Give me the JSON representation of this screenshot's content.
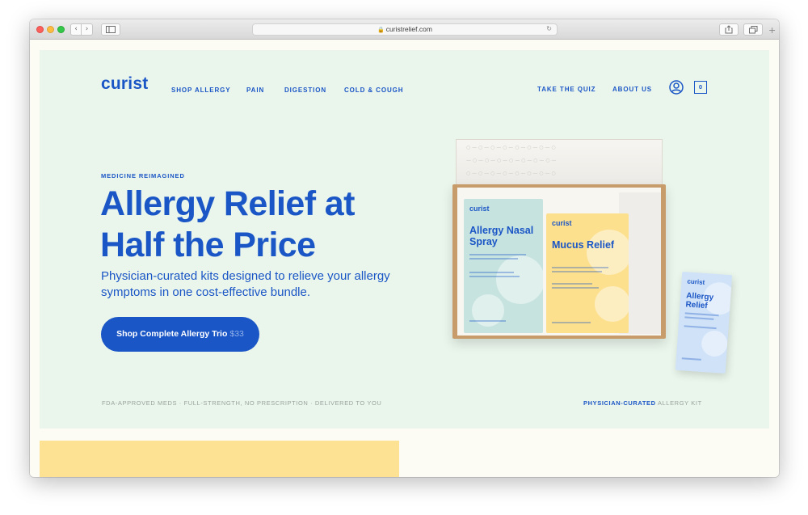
{
  "browser": {
    "url": "curistrelief.com",
    "icons": [
      "back-icon",
      "forward-icon",
      "sidebar-icon",
      "lock-icon",
      "reload-icon",
      "share-icon",
      "tabs-icon",
      "new-tab-icon"
    ]
  },
  "nav": {
    "logo": "curist",
    "links": [
      "SHOP ALLERGY",
      "PAIN",
      "DIGESTION",
      "COLD & COUGH"
    ],
    "right_links": [
      "TAKE THE QUIZ",
      "ABOUT US"
    ],
    "cart_count": "0"
  },
  "hero": {
    "kicker": "MEDICINE REIMAGINED",
    "headline": "Allergy Relief at Half the Price",
    "subhead": "Physician-curated kits designed to relieve your allergy symptoms in one cost-effective bundle.",
    "cta_label": "Shop Complete Allergy Trio",
    "cta_price": "$33"
  },
  "footer": {
    "left": "FDA-APPROVED MEDS · FULL-STRENGTH, NO PRESCRIPTION · DELIVERED TO YOU",
    "right_strong": "PHYSICIAN-CURATED",
    "right_rest": "ALLERGY KIT"
  },
  "products": {
    "nasal": {
      "brand": "curist",
      "title": "Allergy Nasal Spray"
    },
    "mucus": {
      "brand": "curist",
      "title": "Mucus Relief"
    },
    "allergy": {
      "brand": "curist",
      "title": "Allergy Relief"
    }
  },
  "colors": {
    "brand_blue": "#1b56c6",
    "hero_bg": "#eaf6ec",
    "yellow": "#fde294"
  }
}
